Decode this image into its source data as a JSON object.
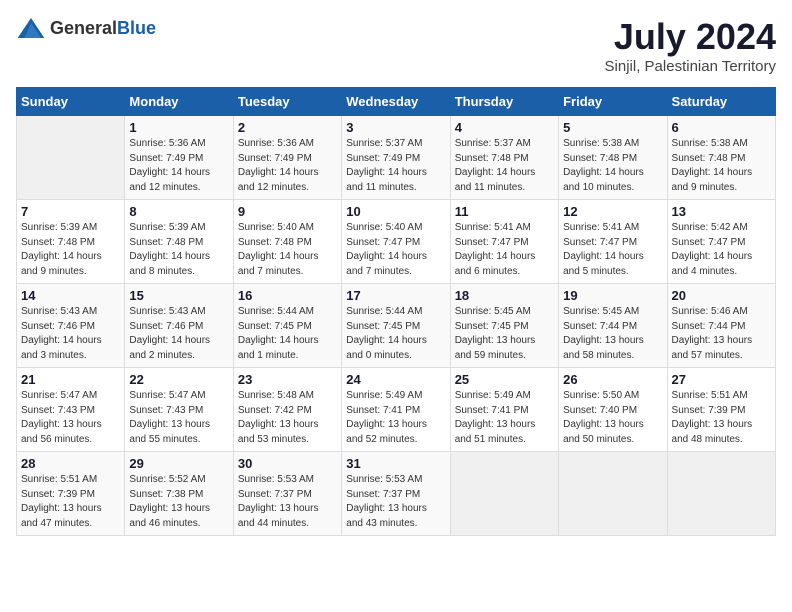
{
  "header": {
    "logo_general": "General",
    "logo_blue": "Blue",
    "title": "July 2024",
    "subtitle": "Sinjil, Palestinian Territory"
  },
  "days_of_week": [
    "Sunday",
    "Monday",
    "Tuesday",
    "Wednesday",
    "Thursday",
    "Friday",
    "Saturday"
  ],
  "weeks": [
    [
      {
        "day": "",
        "info": ""
      },
      {
        "day": "1",
        "info": "Sunrise: 5:36 AM\nSunset: 7:49 PM\nDaylight: 14 hours\nand 12 minutes."
      },
      {
        "day": "2",
        "info": "Sunrise: 5:36 AM\nSunset: 7:49 PM\nDaylight: 14 hours\nand 12 minutes."
      },
      {
        "day": "3",
        "info": "Sunrise: 5:37 AM\nSunset: 7:49 PM\nDaylight: 14 hours\nand 11 minutes."
      },
      {
        "day": "4",
        "info": "Sunrise: 5:37 AM\nSunset: 7:48 PM\nDaylight: 14 hours\nand 11 minutes."
      },
      {
        "day": "5",
        "info": "Sunrise: 5:38 AM\nSunset: 7:48 PM\nDaylight: 14 hours\nand 10 minutes."
      },
      {
        "day": "6",
        "info": "Sunrise: 5:38 AM\nSunset: 7:48 PM\nDaylight: 14 hours\nand 9 minutes."
      }
    ],
    [
      {
        "day": "7",
        "info": "Sunrise: 5:39 AM\nSunset: 7:48 PM\nDaylight: 14 hours\nand 9 minutes."
      },
      {
        "day": "8",
        "info": "Sunrise: 5:39 AM\nSunset: 7:48 PM\nDaylight: 14 hours\nand 8 minutes."
      },
      {
        "day": "9",
        "info": "Sunrise: 5:40 AM\nSunset: 7:48 PM\nDaylight: 14 hours\nand 7 minutes."
      },
      {
        "day": "10",
        "info": "Sunrise: 5:40 AM\nSunset: 7:47 PM\nDaylight: 14 hours\nand 7 minutes."
      },
      {
        "day": "11",
        "info": "Sunrise: 5:41 AM\nSunset: 7:47 PM\nDaylight: 14 hours\nand 6 minutes."
      },
      {
        "day": "12",
        "info": "Sunrise: 5:41 AM\nSunset: 7:47 PM\nDaylight: 14 hours\nand 5 minutes."
      },
      {
        "day": "13",
        "info": "Sunrise: 5:42 AM\nSunset: 7:47 PM\nDaylight: 14 hours\nand 4 minutes."
      }
    ],
    [
      {
        "day": "14",
        "info": "Sunrise: 5:43 AM\nSunset: 7:46 PM\nDaylight: 14 hours\nand 3 minutes."
      },
      {
        "day": "15",
        "info": "Sunrise: 5:43 AM\nSunset: 7:46 PM\nDaylight: 14 hours\nand 2 minutes."
      },
      {
        "day": "16",
        "info": "Sunrise: 5:44 AM\nSunset: 7:45 PM\nDaylight: 14 hours\nand 1 minute."
      },
      {
        "day": "17",
        "info": "Sunrise: 5:44 AM\nSunset: 7:45 PM\nDaylight: 14 hours\nand 0 minutes."
      },
      {
        "day": "18",
        "info": "Sunrise: 5:45 AM\nSunset: 7:45 PM\nDaylight: 13 hours\nand 59 minutes."
      },
      {
        "day": "19",
        "info": "Sunrise: 5:45 AM\nSunset: 7:44 PM\nDaylight: 13 hours\nand 58 minutes."
      },
      {
        "day": "20",
        "info": "Sunrise: 5:46 AM\nSunset: 7:44 PM\nDaylight: 13 hours\nand 57 minutes."
      }
    ],
    [
      {
        "day": "21",
        "info": "Sunrise: 5:47 AM\nSunset: 7:43 PM\nDaylight: 13 hours\nand 56 minutes."
      },
      {
        "day": "22",
        "info": "Sunrise: 5:47 AM\nSunset: 7:43 PM\nDaylight: 13 hours\nand 55 minutes."
      },
      {
        "day": "23",
        "info": "Sunrise: 5:48 AM\nSunset: 7:42 PM\nDaylight: 13 hours\nand 53 minutes."
      },
      {
        "day": "24",
        "info": "Sunrise: 5:49 AM\nSunset: 7:41 PM\nDaylight: 13 hours\nand 52 minutes."
      },
      {
        "day": "25",
        "info": "Sunrise: 5:49 AM\nSunset: 7:41 PM\nDaylight: 13 hours\nand 51 minutes."
      },
      {
        "day": "26",
        "info": "Sunrise: 5:50 AM\nSunset: 7:40 PM\nDaylight: 13 hours\nand 50 minutes."
      },
      {
        "day": "27",
        "info": "Sunrise: 5:51 AM\nSunset: 7:39 PM\nDaylight: 13 hours\nand 48 minutes."
      }
    ],
    [
      {
        "day": "28",
        "info": "Sunrise: 5:51 AM\nSunset: 7:39 PM\nDaylight: 13 hours\nand 47 minutes."
      },
      {
        "day": "29",
        "info": "Sunrise: 5:52 AM\nSunset: 7:38 PM\nDaylight: 13 hours\nand 46 minutes."
      },
      {
        "day": "30",
        "info": "Sunrise: 5:53 AM\nSunset: 7:37 PM\nDaylight: 13 hours\nand 44 minutes."
      },
      {
        "day": "31",
        "info": "Sunrise: 5:53 AM\nSunset: 7:37 PM\nDaylight: 13 hours\nand 43 minutes."
      },
      {
        "day": "",
        "info": ""
      },
      {
        "day": "",
        "info": ""
      },
      {
        "day": "",
        "info": ""
      }
    ]
  ]
}
